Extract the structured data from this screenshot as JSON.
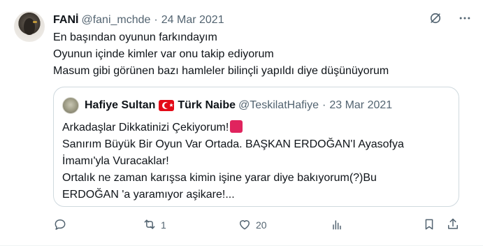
{
  "author": {
    "name": "FANİ",
    "handle": "@fani_mchde",
    "separator": "·",
    "date": "24 Mar 2021"
  },
  "tweet": {
    "lines": [
      "En başından oyunun farkındayım",
      "Oyunun içinde kimler var onu takip ediyorum",
      "Masum gibi görünen bazı hamleler bilinçli yapıldı diye düşünüyorum"
    ]
  },
  "quote": {
    "name_part1": "Hafiye Sultan",
    "name_part2": "Türk Naibe",
    "handle": "@TeskilatHafiye",
    "separator": "·",
    "date": "23 Mar 2021",
    "lines": [
      "Arkadaşlar Dikkatinizi Çekiyorum!",
      "Sanırım Büyük Bir Oyun Var Ortada. BAŞKAN ERDOĞAN'I Ayasofya",
      "İmamı'yla Vuracaklar!",
      "Ortalık ne zaman karışsa kimin işine yarar diye bakıyorum(?)Bu",
      "ERDOĞAN 'a yaramıyor aşikare!..."
    ]
  },
  "actions": {
    "reply_count": "",
    "retweet_count": "1",
    "like_count": "20",
    "views_count": ""
  },
  "icons": {
    "top": [
      "grok-slash-icon",
      "more-icon"
    ],
    "actions": [
      "reply-icon",
      "retweet-icon",
      "like-icon",
      "views-icon",
      "bookmark-icon",
      "share-icon"
    ]
  },
  "colors": {
    "text": "#0f1419",
    "secondary": "#536471",
    "border": "#cfd9de",
    "flag_red": "#e30a17",
    "square_red": "#e0245e"
  }
}
